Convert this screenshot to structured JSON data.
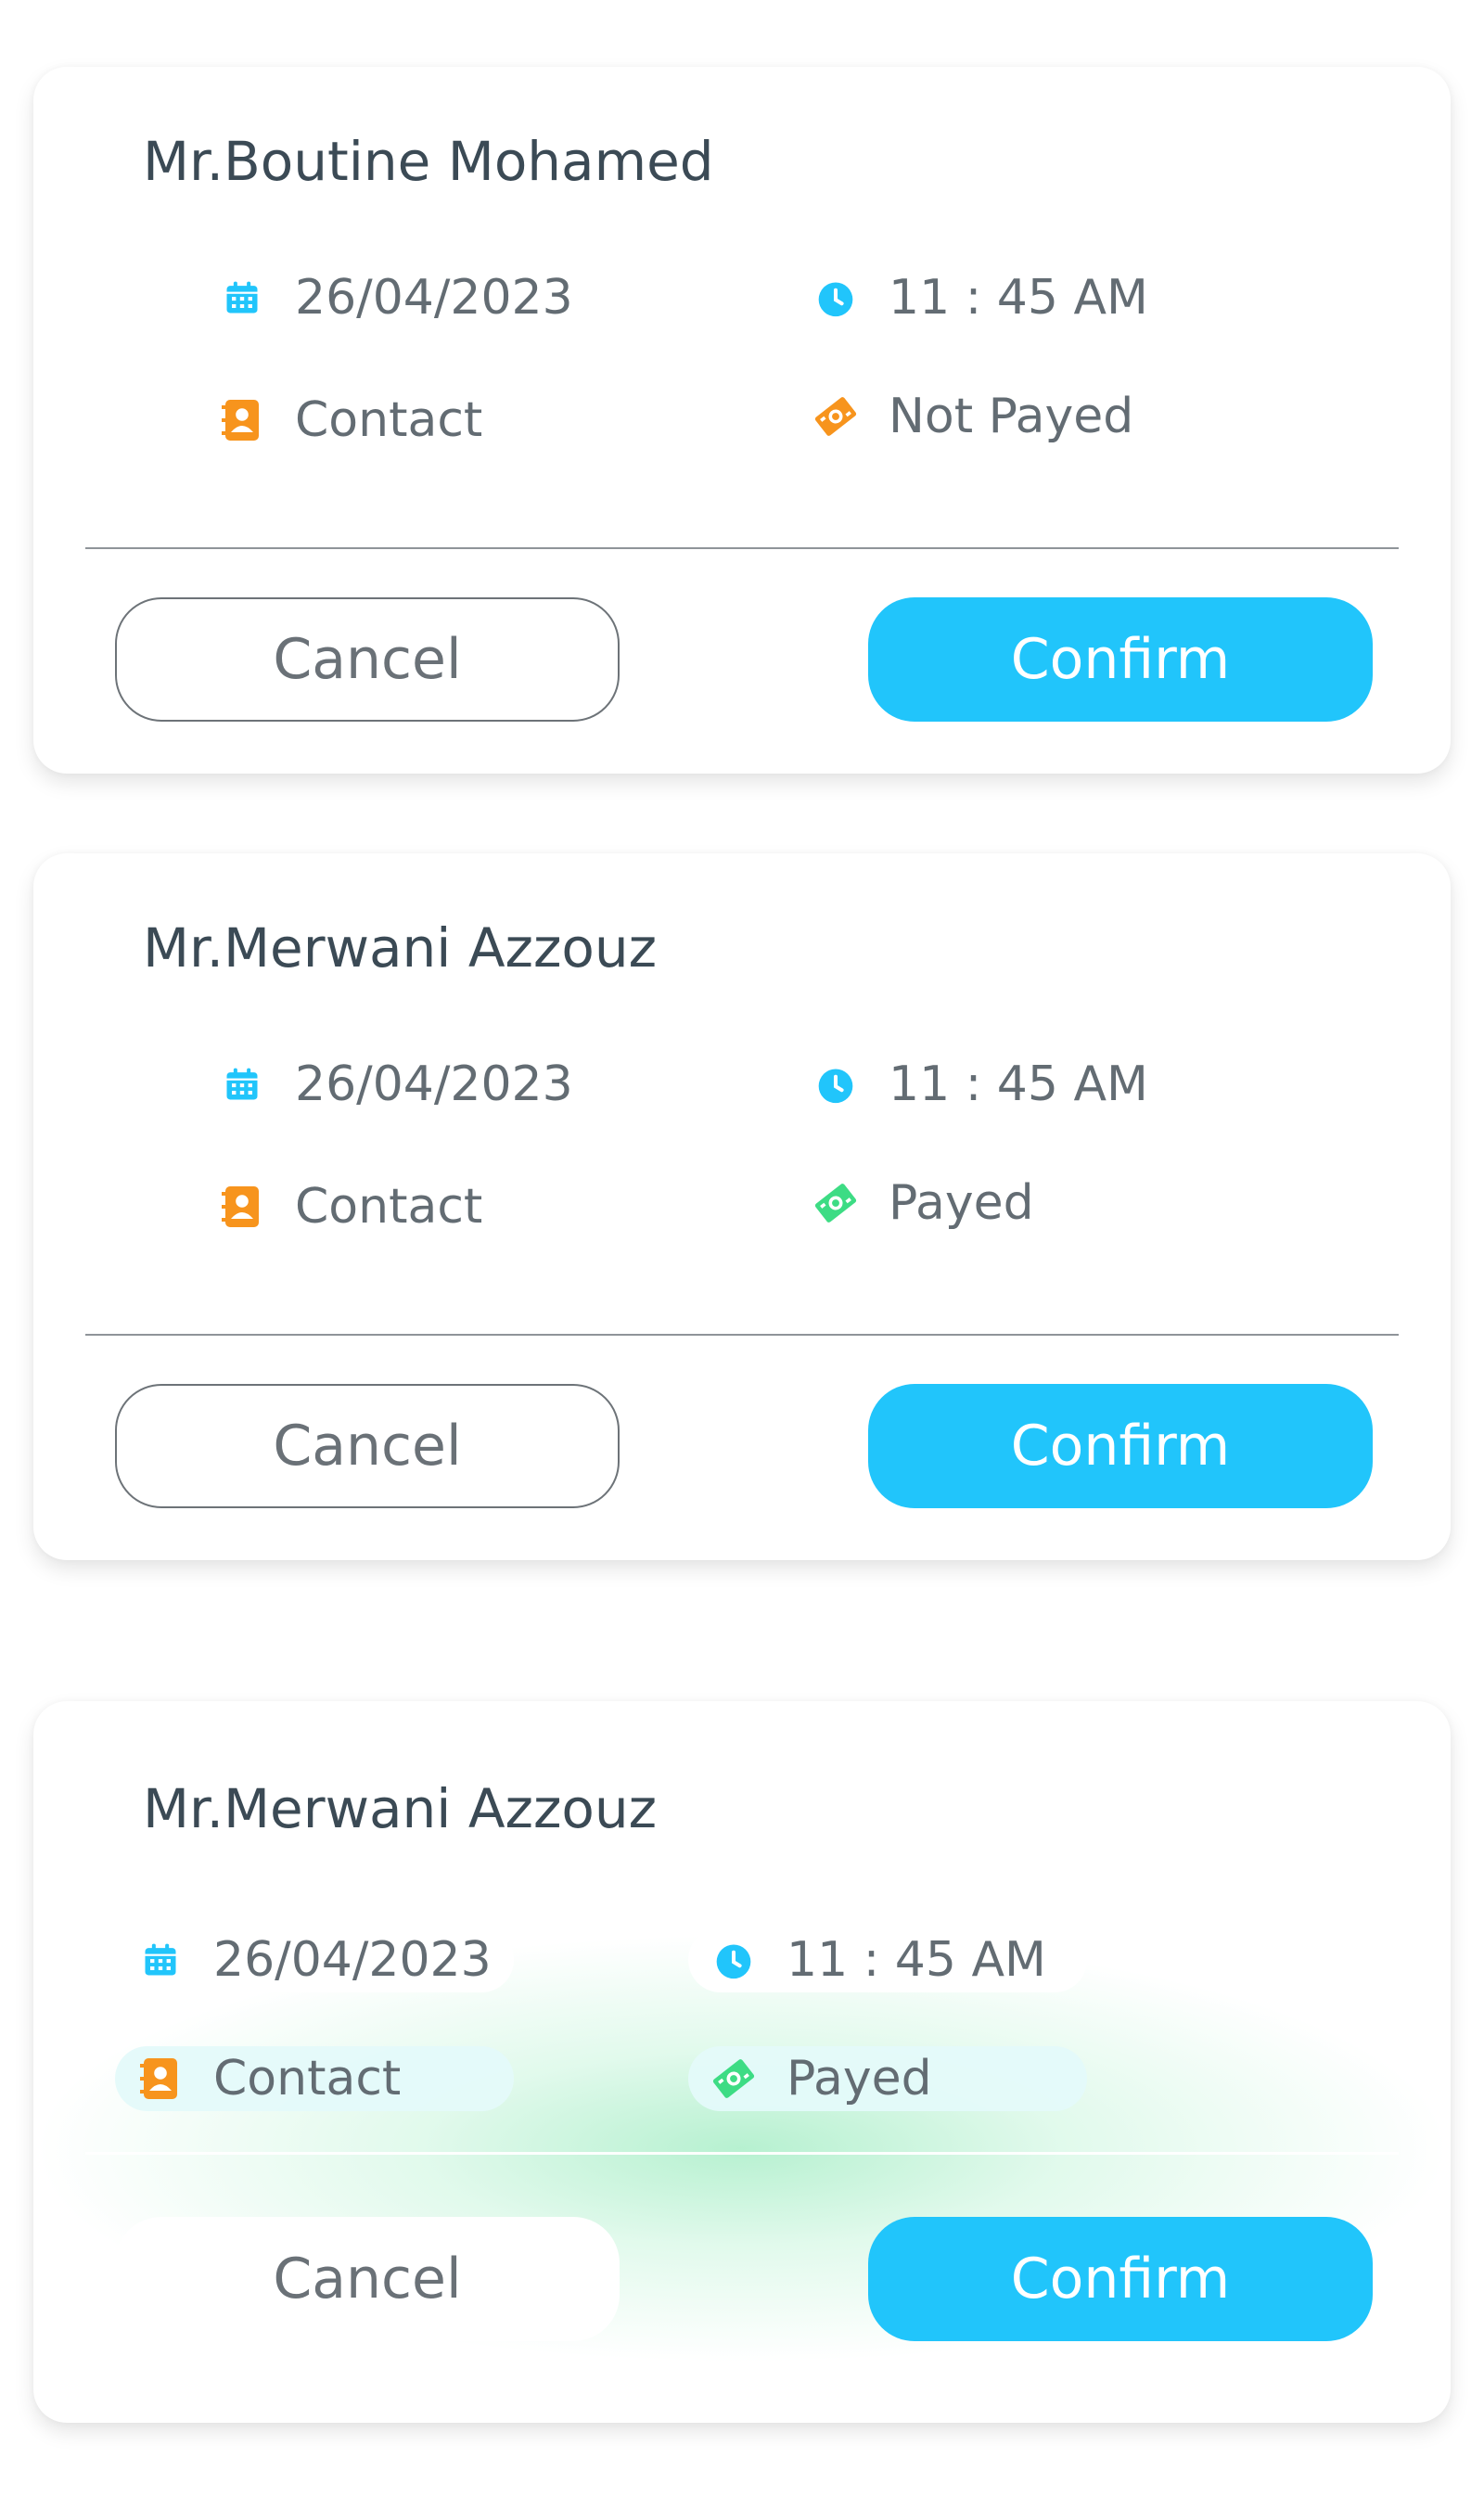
{
  "colors": {
    "accent": "#21c5fb",
    "contact_icon": "#f7941d",
    "not_payed_icon": "#f7941d",
    "payed_icon": "#3ddc84",
    "calendar_icon": "#21c5fb",
    "clock_icon": "#21c5fb"
  },
  "appointments": [
    {
      "name": "Mr.Boutine Mohamed",
      "date": "26/04/2023",
      "time": "11 : 45 AM",
      "contact_label": "Contact",
      "payment_status": "Not Payed",
      "cancel_label": "Cancel",
      "confirm_label": "Confirm"
    },
    {
      "name": "Mr.Merwani Azzouz",
      "date": "26/04/2023",
      "time": "11 : 45 AM",
      "contact_label": "Contact",
      "payment_status": "Payed",
      "cancel_label": "Cancel",
      "confirm_label": "Confirm"
    },
    {
      "name": "Mr.Merwani Azzouz",
      "date": "26/04/2023",
      "time": "11 : 45 AM",
      "contact_label": "Contact",
      "payment_status": "Payed",
      "cancel_label": "Cancel",
      "confirm_label": "Confirm"
    }
  ],
  "icons": {
    "date": "calendar-icon",
    "time": "clock-icon",
    "contact": "contact-book-icon",
    "payment": "money-bill-icon"
  }
}
